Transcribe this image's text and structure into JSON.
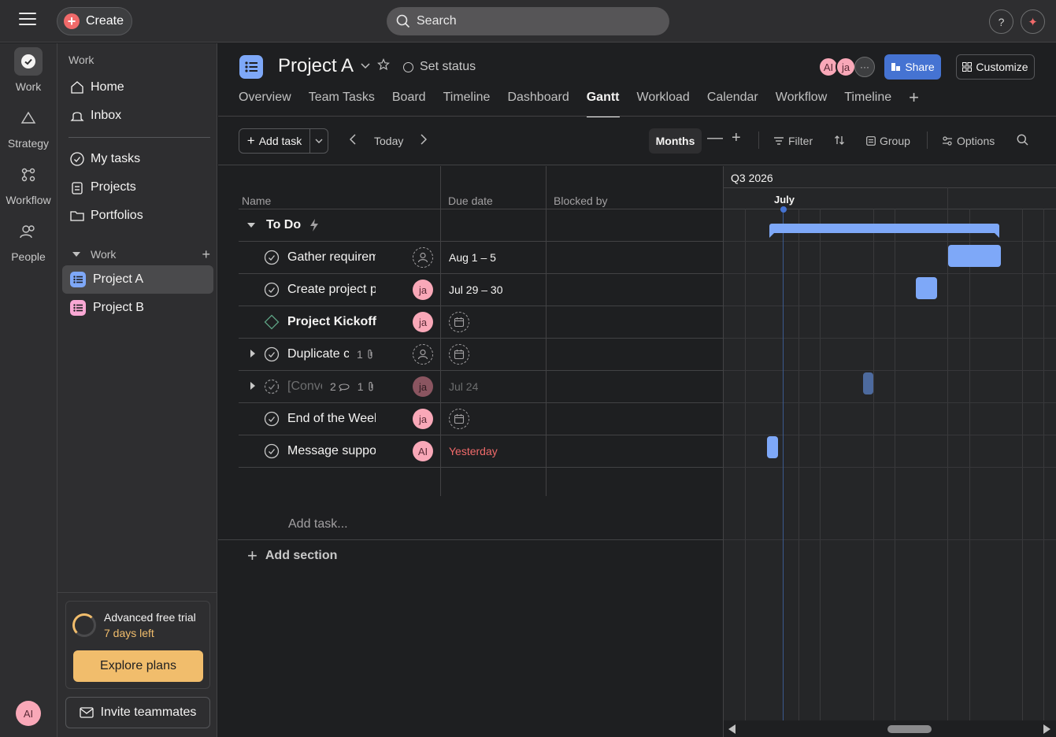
{
  "topbar": {
    "create_label": "Create",
    "search_placeholder": "Search",
    "help_label": "?"
  },
  "rail": {
    "items": [
      {
        "label": "Work",
        "icon": "check-circle-icon"
      },
      {
        "label": "Strategy",
        "icon": "triangle-icon"
      },
      {
        "label": "Workflow",
        "icon": "workflow-icon"
      },
      {
        "label": "People",
        "icon": "people-icon"
      }
    ],
    "avatar": "AI"
  },
  "sidebar": {
    "heading": "Work",
    "top_items": [
      {
        "label": "Home",
        "icon": "home-icon"
      },
      {
        "label": "Inbox",
        "icon": "bell-icon"
      }
    ],
    "mid_items": [
      {
        "label": "My tasks",
        "icon": "check-circle-icon"
      },
      {
        "label": "Projects",
        "icon": "clipboard-icon"
      },
      {
        "label": "Portfolios",
        "icon": "folder-icon"
      }
    ],
    "section_label": "Work",
    "projects": [
      {
        "label": "Project A",
        "color": "#7ea8f8"
      },
      {
        "label": "Project B",
        "color": "#f9a8d4"
      }
    ],
    "trial": {
      "title": "Advanced free trial",
      "days": "7 days left",
      "explore_label": "Explore plans"
    },
    "invite_label": "Invite teammates"
  },
  "header": {
    "project_title": "Project A",
    "set_status": "Set status",
    "members": [
      {
        "initials": "AI",
        "color": "#f9a8b8"
      },
      {
        "initials": "ja",
        "color": "#f9a8b8"
      }
    ],
    "more_label": "···",
    "share_label": "Share",
    "customize_label": "Customize",
    "tabs": [
      "Overview",
      "Team Tasks",
      "Board",
      "Timeline",
      "Dashboard",
      "Gantt",
      "Workload",
      "Calendar",
      "Workflow",
      "Timeline"
    ],
    "active_tab": "Gantt"
  },
  "toolbar": {
    "add_task_label": "Add task",
    "today_label": "Today",
    "months_label": "Months",
    "filter_label": "Filter",
    "group_label": "Group",
    "options_label": "Options"
  },
  "grid": {
    "columns": [
      "Name",
      "Due date",
      "Blocked by"
    ],
    "section_title": "To Do",
    "tasks": [
      {
        "name": "Gather requirem",
        "assignee": "",
        "due": "Aug 1 – 5",
        "type": "task"
      },
      {
        "name": "Create project p",
        "assignee": "ja",
        "due": "Jul 29 – 30",
        "type": "task"
      },
      {
        "name": "Project Kickoff",
        "assignee": "ja",
        "due": "",
        "type": "milestone"
      },
      {
        "name": "Duplicate c",
        "assignee": "",
        "due": "",
        "type": "task",
        "subtasks": "1",
        "attachments": "1"
      },
      {
        "name": "[Conve",
        "assignee": "ja",
        "due": "Jul 24",
        "type": "task-muted",
        "comments": "2",
        "attachments": "1"
      },
      {
        "name": "End of the Week",
        "assignee": "ja",
        "due": "",
        "type": "task"
      },
      {
        "name": "Message suppor",
        "assignee": "AI",
        "due": "Yesterday",
        "type": "task",
        "due_status": "overdue"
      }
    ],
    "add_task_placeholder": "Add task...",
    "add_section_label": "Add section"
  },
  "gantt": {
    "quarter": "Q3 2026",
    "month": "July"
  }
}
